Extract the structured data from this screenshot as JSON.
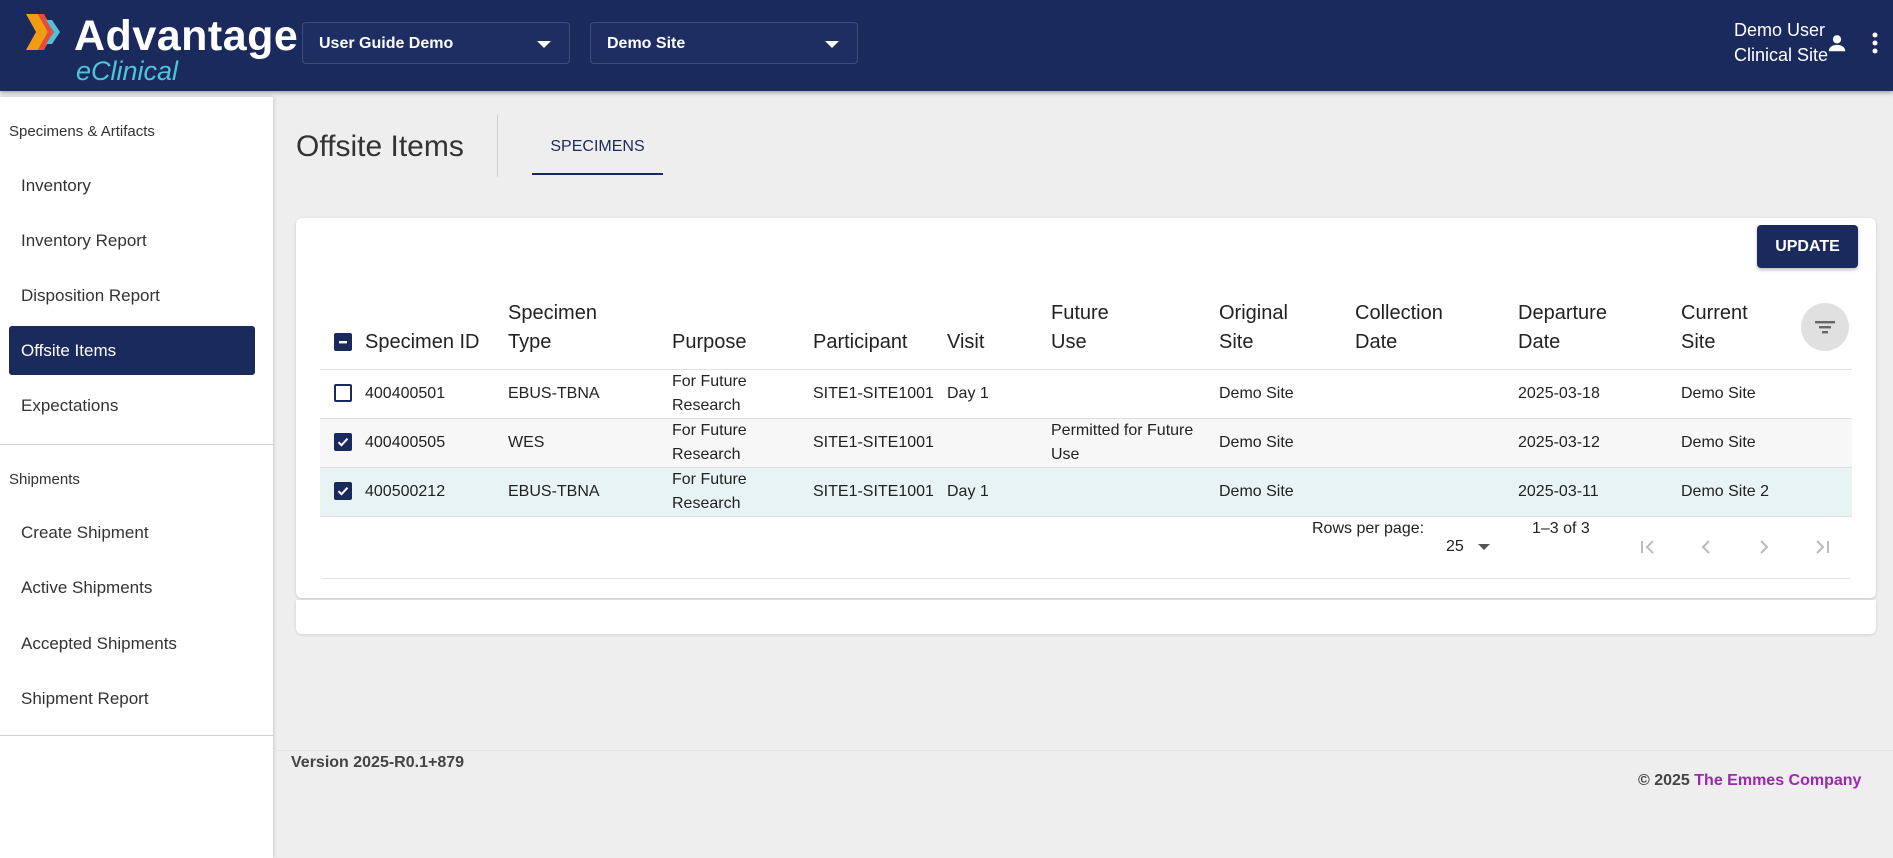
{
  "header": {
    "logo_title": "Advantage",
    "logo_sub": "eClinical",
    "study_select": "User Guide Demo",
    "site_select": "Demo Site",
    "user_name": "Demo User",
    "user_role": "Clinical Site"
  },
  "sidebar": {
    "section1": "Specimens & Artifacts",
    "items1": [
      "Inventory",
      "Inventory Report",
      "Disposition Report",
      "Offsite Items",
      "Expectations"
    ],
    "section2": "Shipments",
    "items2": [
      "Create Shipment",
      "Active Shipments",
      "Accepted Shipments",
      "Shipment Report"
    ]
  },
  "main": {
    "title": "Offsite Items",
    "tab": "SPECIMENS",
    "update_label": "UPDATE",
    "columns": [
      "Specimen ID",
      "Specimen Type",
      "Purpose",
      "Participant",
      "Visit",
      "Future Use",
      "Original Site",
      "Collection Date",
      "Departure Date",
      "Current Site"
    ],
    "rows": [
      {
        "checked": false,
        "id": "400400501",
        "type": "EBUS-TBNA",
        "purpose": "For Future Research",
        "participant": "SITE1-SITE1001",
        "visit": "Day 1",
        "future_use": "",
        "original_site": "Demo Site",
        "collection_date": "",
        "departure_date": "2025-03-18",
        "current_site": "Demo Site"
      },
      {
        "checked": true,
        "id": "400400505",
        "type": "WES",
        "purpose": "For Future Research",
        "participant": "SITE1-SITE1001",
        "visit": "",
        "future_use": "Permitted for Future Use",
        "original_site": "Demo Site",
        "collection_date": "",
        "departure_date": "2025-03-12",
        "current_site": "Demo Site"
      },
      {
        "checked": true,
        "id": "400500212",
        "type": "EBUS-TBNA",
        "purpose": "For Future Research",
        "participant": "SITE1-SITE1001",
        "visit": "Day 1",
        "future_use": "",
        "original_site": "Demo Site",
        "collection_date": "",
        "departure_date": "2025-03-11",
        "current_site": "Demo Site 2"
      }
    ],
    "pagination": {
      "rows_label": "Rows per page:",
      "rows_value": "25",
      "range": "1–3 of 3"
    }
  },
  "footer": {
    "version": "Version 2025-R0.1+879",
    "copyright_prefix": "© 2025",
    "company": "The Emmes Company"
  },
  "colors": {
    "brand": "#1b2a5c",
    "accent": "#4fc3d9",
    "link": "#9c27b0"
  }
}
